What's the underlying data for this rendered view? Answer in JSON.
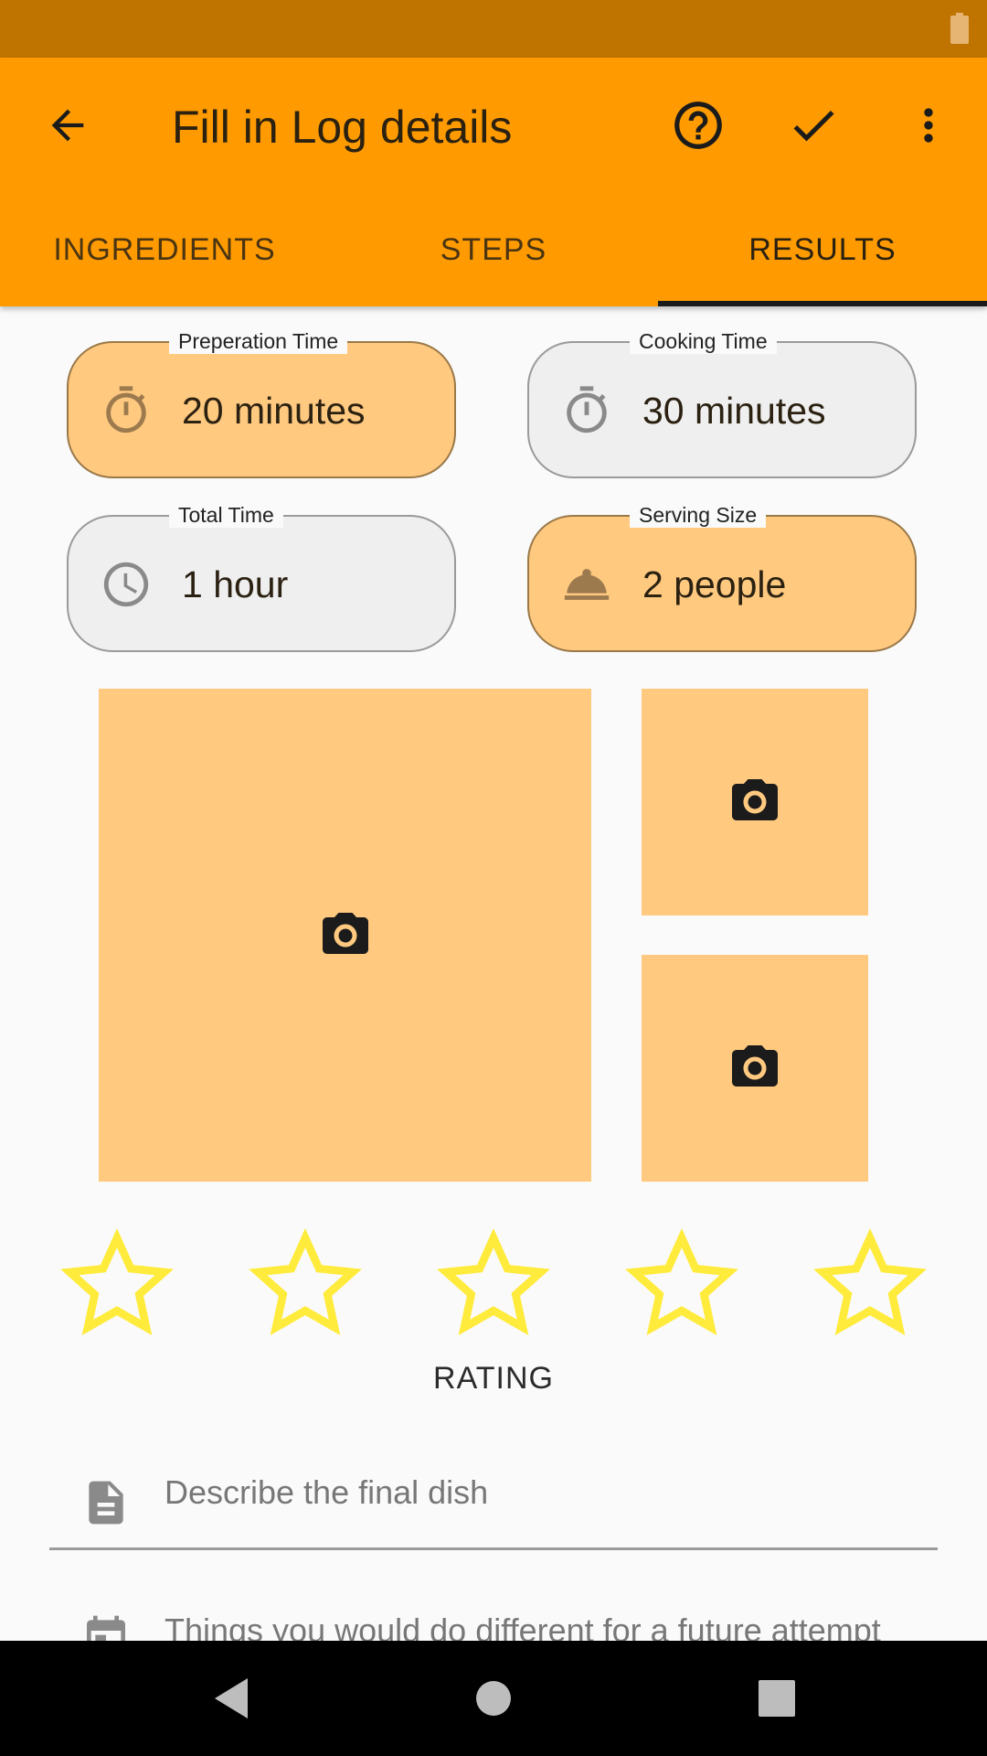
{
  "colors": {
    "status_bar": "#c07400",
    "app_bar": "#ff9b00",
    "accent_light": "#ffc980",
    "star": "#ffeb3b",
    "tab_indicator": "#1b1b1b"
  },
  "header": {
    "title": "Fill in Log details",
    "back_icon": "arrow-back-icon",
    "help_icon": "help-circle-icon",
    "confirm_icon": "check-icon",
    "menu_icon": "more-vert-icon"
  },
  "tabs": [
    {
      "label": "INGREDIENTS",
      "active": false
    },
    {
      "label": "STEPS",
      "active": false
    },
    {
      "label": "RESULTS",
      "active": true
    }
  ],
  "fields": {
    "prep_time": {
      "label": "Preperation Time",
      "value": "20 minutes",
      "icon": "timer-icon"
    },
    "cook_time": {
      "label": "Cooking Time",
      "value": "30 minutes",
      "icon": "timer-icon"
    },
    "total_time": {
      "label": "Total Time",
      "value": "1 hour",
      "icon": "clock-icon"
    },
    "serving_size": {
      "label": "Serving Size",
      "value": "2 people",
      "icon": "room-service-icon"
    }
  },
  "photos": [
    {
      "icon": "camera-icon"
    },
    {
      "icon": "camera-icon"
    },
    {
      "icon": "camera-icon"
    }
  ],
  "rating": {
    "label": "RATING",
    "value": 0,
    "max": 5
  },
  "description": {
    "placeholder": "Describe the final dish",
    "icon": "description-icon"
  },
  "improvements": {
    "placeholder": "Things you would do different for a future attempt",
    "icon": "calendar-icon"
  }
}
